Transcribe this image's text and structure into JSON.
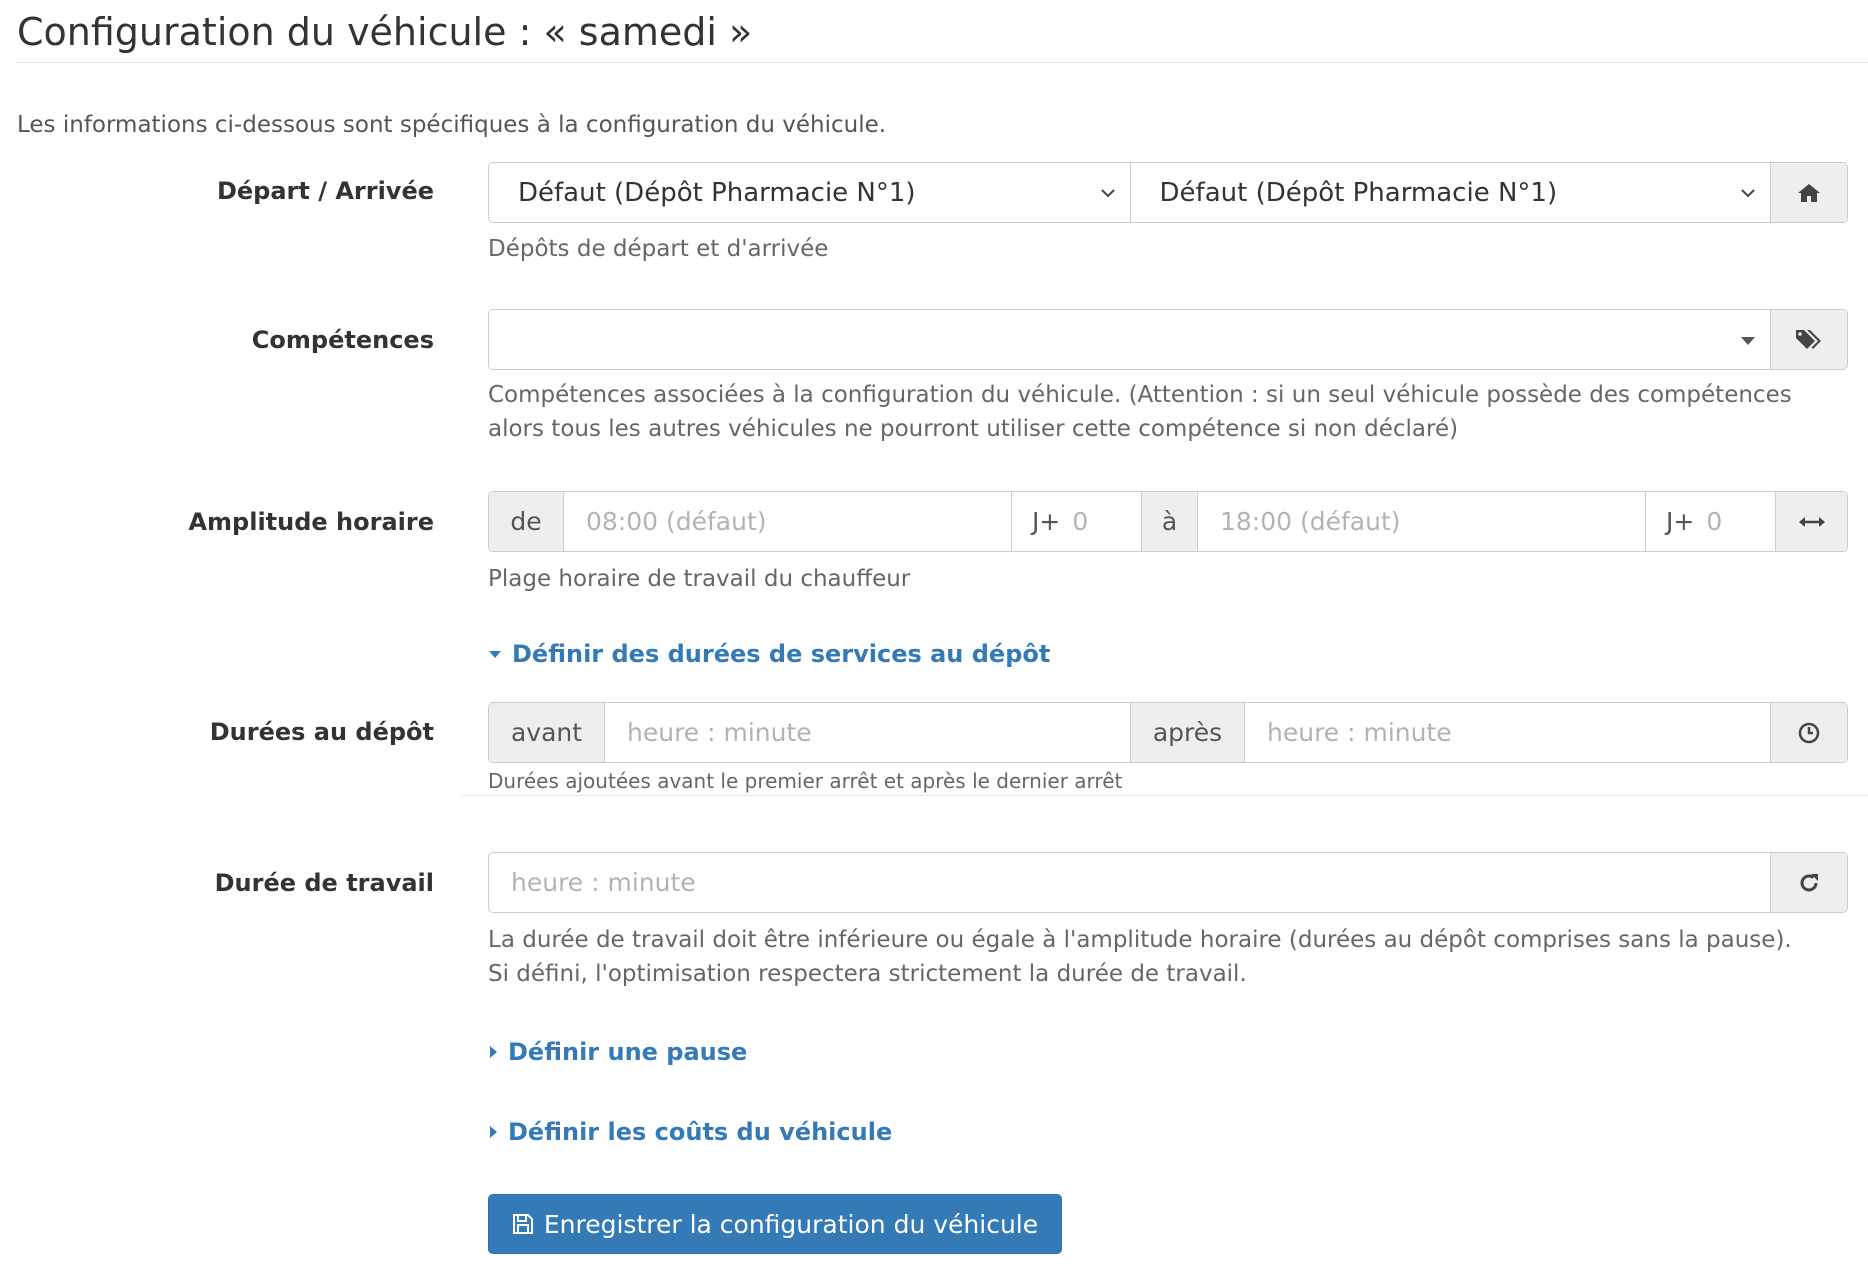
{
  "page": {
    "title": "Configuration du véhicule : « samedi »",
    "intro": "Les informations ci-dessous sont spécifiques à la configuration du véhicule."
  },
  "departure_arrival": {
    "label": "Départ / Arrivée",
    "departure_value": "Défaut (Dépôt Pharmacie N°1)",
    "arrival_value": "Défaut (Dépôt Pharmacie N°1)",
    "icon": "home-icon",
    "help": "Dépôts de départ et d'arrivée"
  },
  "skills": {
    "label": "Compétences",
    "value": "",
    "icon": "tags-icon",
    "help": "Compétences associées à la configuration du véhicule. (Attention  : si un seul véhicule possède des compétences alors tous les autres véhicules ne pourront utiliser cette compétence si non déclaré)"
  },
  "time_window": {
    "label": "Amplitude horaire",
    "from_prefix": "de",
    "start_placeholder": "08:00 (défaut)",
    "start_day_prefix": "J+",
    "start_day_placeholder": "0",
    "to_prefix": "à",
    "end_placeholder": "18:00 (défaut)",
    "end_day_prefix": "J+",
    "end_day_placeholder": "0",
    "icon": "arrows-horizontal-icon",
    "help": "Plage horaire de travail du chauffeur"
  },
  "service_toggle": {
    "label": "Définir des durées de services au dépôt",
    "expanded": true
  },
  "depot_durations": {
    "label": "Durées au dépôt",
    "before_prefix": "avant",
    "before_placeholder": "heure : minute",
    "after_prefix": "après",
    "after_placeholder": "heure : minute",
    "icon": "clock-icon",
    "help": "Durées ajoutées avant le premier arrêt et après le dernier arrêt"
  },
  "work_duration": {
    "label": "Durée de travail",
    "placeholder": "heure : minute",
    "icon": "refresh-icon",
    "help_line1": "La durée de travail doit être inférieure ou égale à l'amplitude horaire (durées au dépôt comprises sans la pause).",
    "help_line2": "Si défini, l'optimisation respectera strictement la durée de travail."
  },
  "pause_toggle": {
    "label": "Définir une pause",
    "expanded": false
  },
  "costs_toggle": {
    "label": "Définir les coûts du véhicule",
    "expanded": false
  },
  "save_button": {
    "label": "Enregistrer la configuration du véhicule",
    "icon": "floppy-disk-icon"
  },
  "colors": {
    "link": "#337ab7",
    "primary": "#337ab7",
    "addon_bg": "#eeeeee",
    "border": "#cccccc"
  }
}
